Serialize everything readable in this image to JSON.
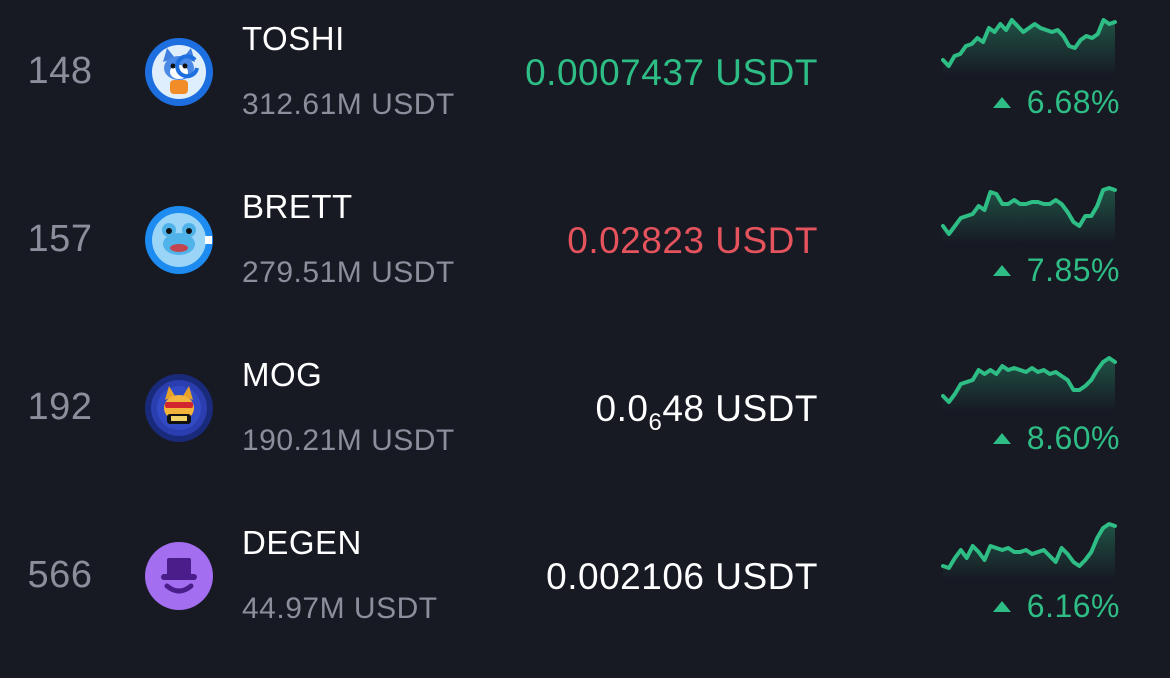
{
  "colors": {
    "background": "#171923",
    "up": "#2ebd85",
    "down": "#e5535d",
    "neutral": "#ffffff",
    "muted": "#8b8e9b"
  },
  "rows": [
    {
      "rank": "148",
      "symbol": "TOSHI",
      "volume": "312.61M USDT",
      "price": "0.0007437 USDT",
      "price_direction": "up",
      "change": "6.68%",
      "change_direction": "up",
      "icon": "toshi-cat-icon",
      "sparkline": [
        42,
        48,
        38,
        36,
        28,
        26,
        20,
        24,
        10,
        14,
        6,
        12,
        2,
        8,
        14,
        10,
        6,
        10,
        12,
        14,
        12,
        18,
        28,
        30,
        22,
        18,
        20,
        16,
        2,
        6,
        4
      ]
    },
    {
      "rank": "157",
      "symbol": "BRETT",
      "volume": "279.51M USDT",
      "price": "0.02823 USDT",
      "price_direction": "down",
      "change": "7.85%",
      "change_direction": "up",
      "icon": "brett-frog-icon",
      "sparkline": [
        40,
        48,
        40,
        32,
        30,
        28,
        20,
        24,
        6,
        8,
        18,
        18,
        14,
        18,
        18,
        16,
        16,
        18,
        18,
        14,
        18,
        26,
        36,
        40,
        30,
        30,
        20,
        4,
        2,
        4
      ]
    },
    {
      "rank": "192",
      "symbol": "MOG",
      "volume": "190.21M USDT",
      "price_parts": {
        "lead": "0.0",
        "zeros": "6",
        "tail": "48 USDT"
      },
      "price_direction": "neutral",
      "change": "8.60%",
      "change_direction": "up",
      "icon": "mog-cat-icon",
      "sparkline": [
        42,
        48,
        40,
        30,
        28,
        26,
        16,
        20,
        16,
        20,
        12,
        16,
        14,
        16,
        18,
        14,
        18,
        16,
        20,
        18,
        22,
        26,
        36,
        36,
        32,
        26,
        16,
        8,
        4,
        8
      ]
    },
    {
      "rank": "566",
      "symbol": "DEGEN",
      "volume": "44.97M USDT",
      "price": "0.002106 USDT",
      "price_direction": "neutral",
      "change": "6.16%",
      "change_direction": "up",
      "icon": "degen-hat-icon",
      "sparkline": [
        44,
        46,
        36,
        28,
        36,
        24,
        30,
        38,
        24,
        26,
        28,
        26,
        30,
        30,
        28,
        32,
        30,
        28,
        34,
        40,
        26,
        32,
        40,
        44,
        38,
        30,
        16,
        6,
        2,
        4
      ]
    }
  ]
}
